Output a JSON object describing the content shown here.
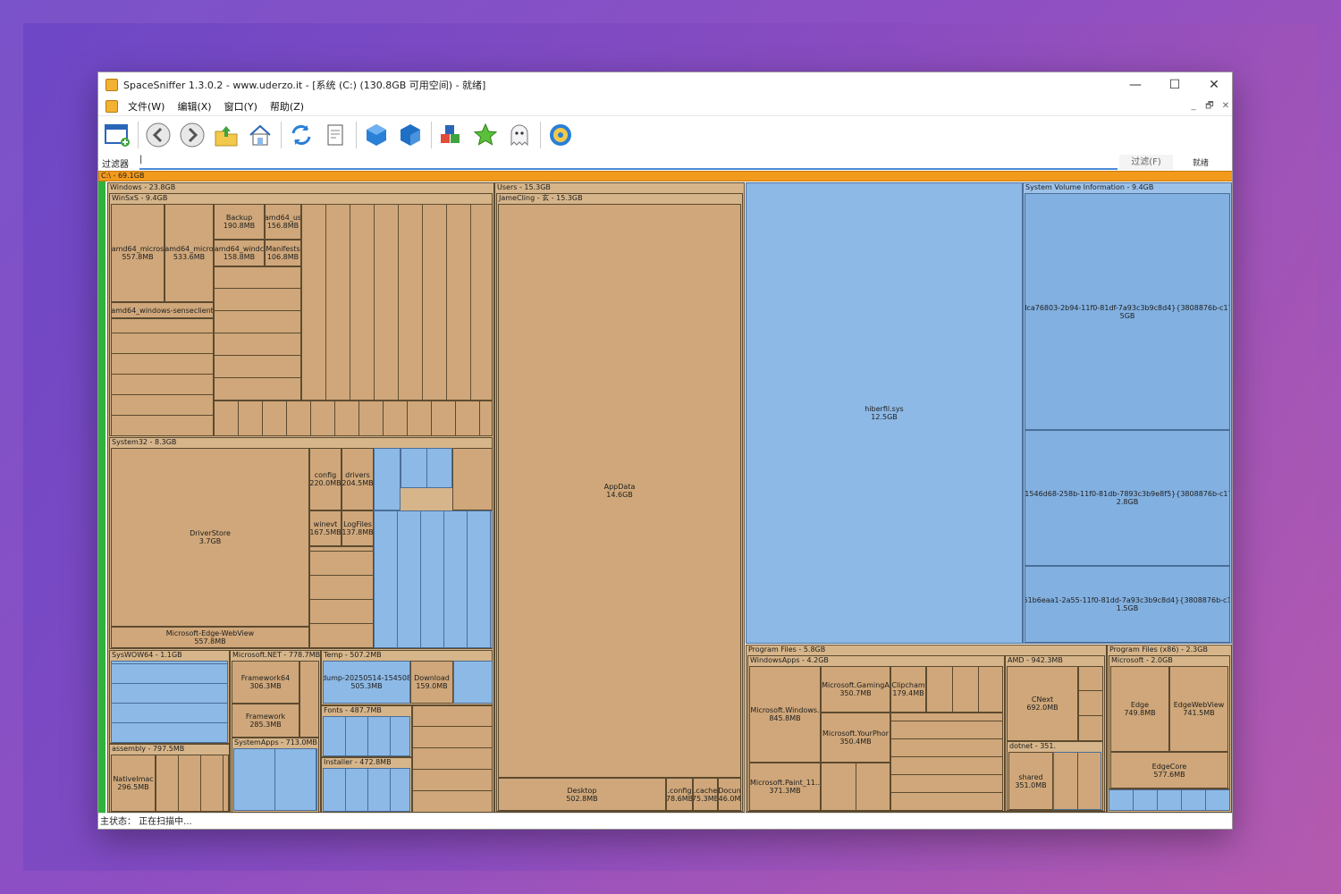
{
  "window": {
    "title": "SpaceSniffer 1.3.0.2 - www.uderzo.it - [系统 (C:) (130.8GB 可用空间) - 就绪]",
    "minimize": "—",
    "maximize": "☐",
    "close": "✕"
  },
  "menu": [
    "文件(W)",
    "编辑(X)",
    "窗口(Y)",
    "帮助(Z)"
  ],
  "mdi": [
    "_",
    "🗗",
    "✕"
  ],
  "toolbar_icons": [
    "new-window-icon",
    "back-icon",
    "forward-icon",
    "up-folder-icon",
    "home-icon",
    "refresh-icon",
    "copy-icon",
    "cube-icon",
    "cube-2-icon",
    "blocks-icon",
    "star-icon",
    "ghost-icon",
    "gear-icon"
  ],
  "filter": {
    "label": "过滤器",
    "value": "|",
    "button": "过滤(F)",
    "status": "就绪"
  },
  "status": "主状态：  正在扫描中...",
  "colors": {
    "accent": "#4b8ad6",
    "root_bar": "#f29a1c",
    "dir": "#d6b58a",
    "blue": "#8db9e6"
  },
  "treemap": {
    "root": "C:\\ - 69.1GB",
    "windows": "Windows - 23.8GB",
    "winsxs": "WinSxS - 9.4GB",
    "system32": "System32 - 8.3GB",
    "syswow": "SysWOW64 - 1.1GB",
    "assembly": "assembly - 797.5MB",
    "dotnet": "Microsoft.NET - 778.7MB",
    "temp": "Temp - 507.2MB",
    "fonts": "Fonts - 487.7MB",
    "sysapps": "SystemApps - 713.0MB",
    "installer": "Installer - 472.8MB",
    "users": "Users - 15.3GB",
    "jamecling": "JameCling - 玄 - 15.3GB",
    "appdata": [
      "AppData",
      "14.6GB"
    ],
    "desktop": [
      "Desktop",
      "502.8MB"
    ],
    "hiberfil": [
      "hiberfil.sys",
      "12.5GB"
    ],
    "svi": "System Volume Information - 9.4GB",
    "svi_items": [
      [
        "{dca76803-2b94-11f0-81df-7a93c3b9c8d4}{3808876b-c176",
        "5GB"
      ],
      [
        "{f1546d68-258b-11f0-81db-7893c3b9e8f5}{3808876b-c176",
        "2.8GB"
      ],
      [
        "{51b6eaa1-2a55-11f0-81dd-7a93c3b9c8d4}{3808876b-c17",
        "1.5GB"
      ]
    ],
    "pf": "Program Files - 5.8GB",
    "windowsapps": "WindowsApps - 4.2GB",
    "amd": "AMD - 942.3MB",
    "pf86": "Program Files (x86) - 2.3GB",
    "ms": "Microsoft - 2.0GB",
    "driverstore": [
      "DriverStore",
      "3.7GB"
    ],
    "edgewebview": [
      "Microsoft-Edge-WebView",
      "557.8MB"
    ],
    "backup": [
      "Backup",
      "190.8MB"
    ],
    "manifests": [
      "Manifests",
      "106.8MB"
    ],
    "config": [
      "config",
      "220.0MB"
    ],
    "drivers": [
      "drivers",
      "204.5MB"
    ],
    "winevt": [
      "winevt",
      "167.5MB"
    ],
    "logfiles": [
      "LogFiles",
      "137.8MB"
    ],
    "framework64": [
      "Framework64",
      "306.3MB"
    ],
    "framework": [
      "Framework",
      "285.3MB"
    ],
    "dump": [
      "dump-20250514-154508",
      "505.3MB"
    ],
    "downloads": [
      "Download",
      "159.0MB"
    ],
    "nativeimages": [
      "NativeImac",
      "296.5MB"
    ],
    "mswindows": [
      "Microsoft.Windows.",
      "845.8MB"
    ],
    "gaming": [
      "Microsoft.GamingA",
      "350.7MB"
    ],
    "yourphone": [
      "Microsoft.YourPhor",
      "350.4MB"
    ],
    "paint": [
      "Microsoft.Paint_11..",
      "371.3MB"
    ],
    "clipchamp": [
      "Clipcham",
      "179.4MB"
    ],
    "cnext": [
      "CNext",
      "692.0MB"
    ],
    "edge": [
      "Edge",
      "749.8MB"
    ],
    "edgewv": [
      "EdgeWebView",
      "741.5MB"
    ],
    "edgecore": [
      "EdgeCore",
      "577.6MB"
    ],
    "shared": [
      "shared",
      "351.0MB"
    ],
    "dotnet351": "dotnet - 351.",
    "config2": [
      ".config",
      "78.6MB"
    ],
    "cache": [
      ".cache",
      "75.3MB"
    ],
    "docun": [
      "Docun",
      "46.0M"
    ],
    "winsxs_cells": [
      [
        "amd64_micros",
        "557.8MB"
      ],
      [
        "amd64_micro",
        "533.6MB"
      ],
      [
        "amd64_windc",
        "158.8MB"
      ],
      [
        "amd64_us",
        "156.8MB"
      ],
      [
        "amd64_windows-senseclient",
        ""
      ]
    ]
  }
}
